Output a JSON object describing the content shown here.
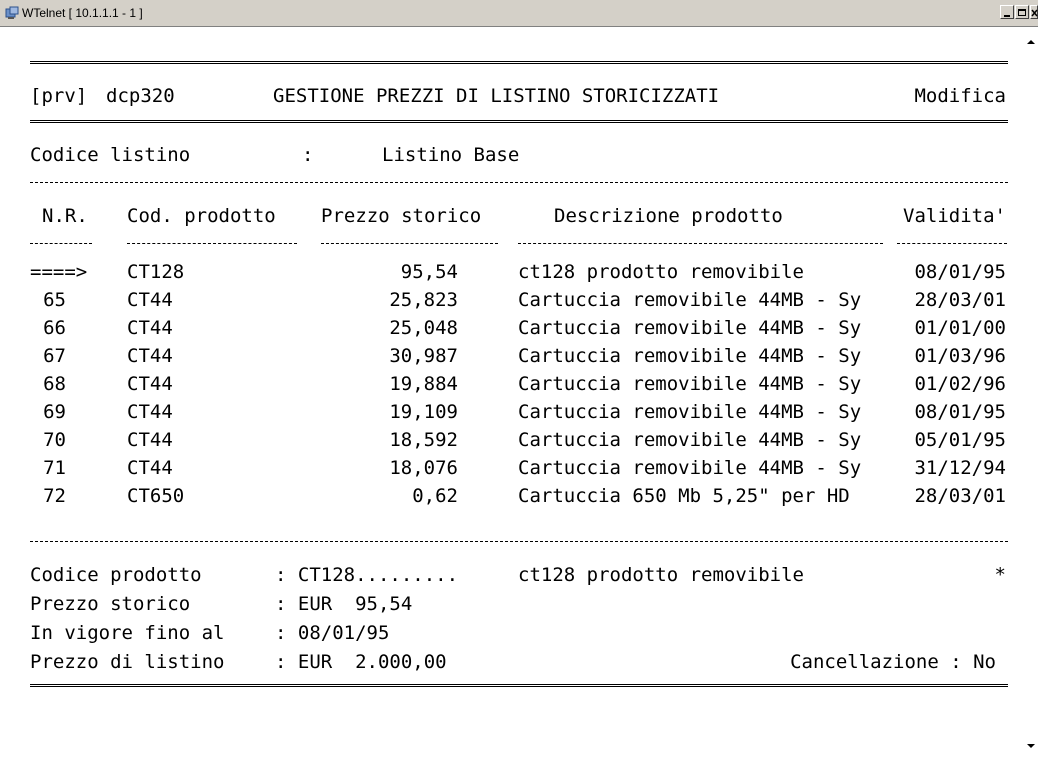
{
  "window": {
    "title": "WTelnet [ 10.1.1.1 - 1 ]",
    "icon": "terminal-app-icon",
    "buttons": [
      "minimize",
      "maximize",
      "close"
    ]
  },
  "header": {
    "prefix": "[prv]",
    "program": "dcp320",
    "title": "GESTIONE PREZZI DI LISTINO STORICIZZATI",
    "mode": "Modifica"
  },
  "listino": {
    "label": "Codice listino",
    "sep": ":",
    "value": "Listino Base"
  },
  "table": {
    "columns": [
      "N.R.",
      "Cod. prodotto",
      "Prezzo storico",
      "Descrizione prodotto",
      "Validita'"
    ],
    "rows": [
      {
        "nr": "====>",
        "code": "CT128",
        "price": "95,54",
        "desc": "ct128 prodotto removibile",
        "date": "08/01/95"
      },
      {
        "nr": "65",
        "code": "CT44",
        "price": "25,823",
        "desc": "Cartuccia removibile 44MB - Sy",
        "date": "28/03/01"
      },
      {
        "nr": "66",
        "code": "CT44",
        "price": "25,048",
        "desc": "Cartuccia removibile 44MB - Sy",
        "date": "01/01/00"
      },
      {
        "nr": "67",
        "code": "CT44",
        "price": "30,987",
        "desc": "Cartuccia removibile 44MB - Sy",
        "date": "01/03/96"
      },
      {
        "nr": "68",
        "code": "CT44",
        "price": "19,884",
        "desc": "Cartuccia removibile 44MB - Sy",
        "date": "01/02/96"
      },
      {
        "nr": "69",
        "code": "CT44",
        "price": "19,109",
        "desc": "Cartuccia removibile 44MB - Sy",
        "date": "08/01/95"
      },
      {
        "nr": "70",
        "code": "CT44",
        "price": "18,592",
        "desc": "Cartuccia removibile 44MB - Sy",
        "date": "05/01/95"
      },
      {
        "nr": "71",
        "code": "CT44",
        "price": "18,076",
        "desc": "Cartuccia removibile 44MB - Sy",
        "date": "31/12/94"
      },
      {
        "nr": "72",
        "code": "CT650",
        "price": "0,62",
        "desc": "Cartuccia 650 Mb 5,25\" per HD",
        "date": "28/03/01"
      }
    ]
  },
  "detail": {
    "codice_label": "Codice prodotto",
    "codice_value": ": CT128.........",
    "codice_desc": "ct128 prodotto removibile",
    "flag": "*",
    "prezzo_label": "Prezzo storico",
    "prezzo_value": ": EUR  95,54",
    "vigore_label": "In vigore fino al",
    "vigore_value": ": 08/01/95",
    "listino_label": "Prezzo di listino",
    "listino_value": ": EUR  2.000,00",
    "cancellazione": "Cancellazione : No"
  },
  "colors": {
    "background": "#ffffff",
    "text": "#000000",
    "chrome": "#d4d0c8"
  }
}
